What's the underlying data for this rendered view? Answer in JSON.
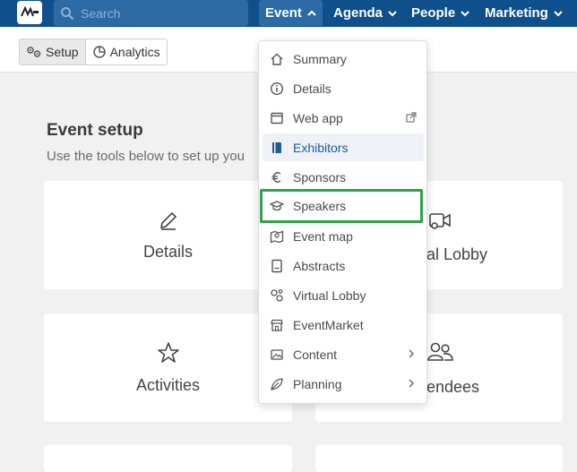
{
  "topbar": {
    "search_placeholder": "Search",
    "nav": [
      {
        "label": "Event"
      },
      {
        "label": "Agenda"
      },
      {
        "label": "People"
      },
      {
        "label": "Marketing"
      }
    ]
  },
  "subbar": {
    "setup_label": "Setup",
    "analytics_label": "Analytics"
  },
  "main": {
    "title": "Event setup",
    "subtitle": "Use the tools below to set up you",
    "cards": [
      {
        "label": "Details",
        "icon": "pencil-icon"
      },
      {
        "label": "al Lobby",
        "icon": "video-gear-icon"
      },
      {
        "label": "Activities",
        "icon": "star-icon"
      },
      {
        "label": "endees",
        "icon": "people-icon"
      }
    ]
  },
  "dropdown": {
    "items": [
      {
        "label": "Summary",
        "icon": "home-icon"
      },
      {
        "label": "Details",
        "icon": "info-icon"
      },
      {
        "label": "Web app",
        "icon": "browser-icon"
      },
      {
        "label": "Exhibitors",
        "icon": "book-icon"
      },
      {
        "label": "Sponsors",
        "icon": "euro-icon"
      },
      {
        "label": "Speakers",
        "icon": "graduation-cap-icon"
      },
      {
        "label": "Event map",
        "icon": "map-icon"
      },
      {
        "label": "Abstracts",
        "icon": "document-icon"
      },
      {
        "label": "Virtual Lobby",
        "icon": "gears-icon"
      },
      {
        "label": "EventMarket",
        "icon": "store-icon"
      },
      {
        "label": "Content",
        "icon": "image-icon"
      },
      {
        "label": "Planning",
        "icon": "leaf-icon"
      }
    ]
  },
  "colors": {
    "topbar": "#0e4f8c",
    "highlight": "#2ea24a",
    "active_text": "#1d5a97"
  }
}
